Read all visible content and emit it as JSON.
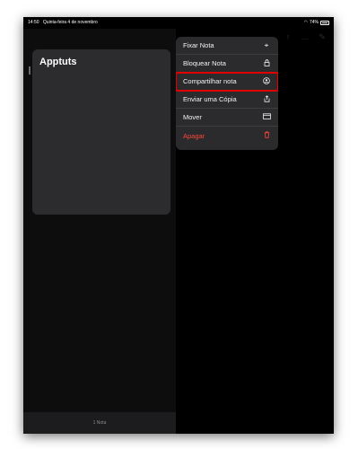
{
  "status_bar": {
    "time": "14:50",
    "date": "Quinta-feira 4 de novembro",
    "battery": "74%"
  },
  "sidebar": {
    "note_title": "Apptuts",
    "footer_count": "1 Nota"
  },
  "context_menu": {
    "items": [
      {
        "label": "Fixar Nota",
        "icon": "pin-icon"
      },
      {
        "label": "Bloquear Nota",
        "icon": "lock-icon"
      },
      {
        "label": "Compartilhar nota",
        "icon": "share-person-icon",
        "highlighted": true
      },
      {
        "label": "Enviar uma Cópia",
        "icon": "share-icon"
      },
      {
        "label": "Mover",
        "icon": "folder-icon"
      },
      {
        "label": "Apagar",
        "icon": "trash-icon",
        "destructive": true
      }
    ]
  },
  "colors": {
    "background": "#000000",
    "card": "#2c2c2e",
    "menu": "#2b2b2d",
    "destructive": "#ff453a",
    "highlight_box": "#e00000"
  }
}
